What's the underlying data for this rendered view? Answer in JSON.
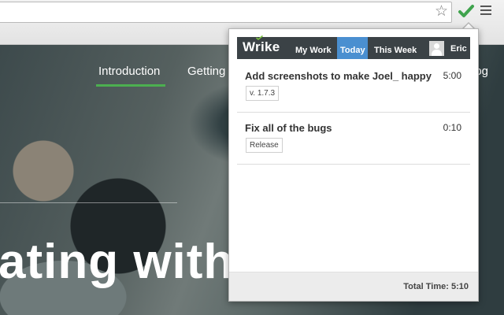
{
  "browser": {
    "star_icon": "star-icon",
    "extension_icon": "wrike-checkmark-icon",
    "menu_icon": "hamburger-menu-icon"
  },
  "site": {
    "nav": [
      {
        "label": "Introduction",
        "active": true
      },
      {
        "label": "Getting s"
      },
      {
        "label": "-log"
      }
    ],
    "hero_text": "ating with"
  },
  "popup": {
    "logo": "Wrike",
    "tabs": [
      {
        "label": "My Work"
      },
      {
        "label": "Today",
        "active": true
      },
      {
        "label": "This Week"
      }
    ],
    "user": {
      "name": "Eric",
      "avatar_icon": "user-avatar-icon"
    },
    "tasks": [
      {
        "title": "Add screenshots to make Joel_ happy",
        "time": "5:00",
        "tag": "v. 1.7.3"
      },
      {
        "title": "Fix all of the bugs",
        "time": "0:10",
        "tag": "Release"
      }
    ],
    "total_time": "Total Time: 5:10"
  },
  "colors": {
    "accent_active_tab": "#4a8fd0",
    "header_bg": "#3b4246",
    "nav_underline": "#4caf50",
    "check_green": "#3fa34d"
  }
}
